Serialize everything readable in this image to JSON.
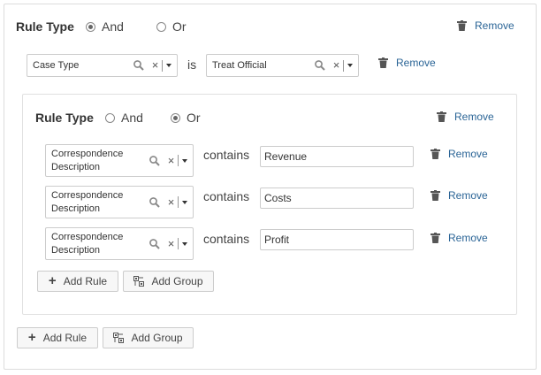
{
  "outer": {
    "rule_type_label": "Rule Type",
    "radio_and_label": "And",
    "radio_or_label": "Or",
    "selected": "And",
    "remove_label": "Remove",
    "rule": {
      "field_value": "Case Type",
      "operator": "is",
      "value_select": "Treat Official",
      "remove_label": "Remove"
    },
    "add_rule_label": "Add Rule",
    "add_group_label": "Add Group"
  },
  "inner": {
    "rule_type_label": "Rule Type",
    "radio_and_label": "And",
    "radio_or_label": "Or",
    "selected": "Or",
    "remove_label": "Remove",
    "rules": [
      {
        "field_line1": "Correspondence",
        "field_line2": "Description",
        "operator": "contains",
        "value": "Revenue",
        "remove_label": "Remove"
      },
      {
        "field_line1": "Correspondence",
        "field_line2": "Description",
        "operator": "contains",
        "value": "Costs",
        "remove_label": "Remove"
      },
      {
        "field_line1": "Correspondence",
        "field_line2": "Description",
        "operator": "contains",
        "value": "Profit",
        "remove_label": "Remove"
      }
    ],
    "add_rule_label": "Add Rule",
    "add_group_label": "Add Group"
  },
  "icons": {
    "clear_glyph": "×",
    "remove": "trash-icon",
    "search": "search-icon",
    "add_rule": "plus-icon",
    "add_group": "group-icon"
  }
}
